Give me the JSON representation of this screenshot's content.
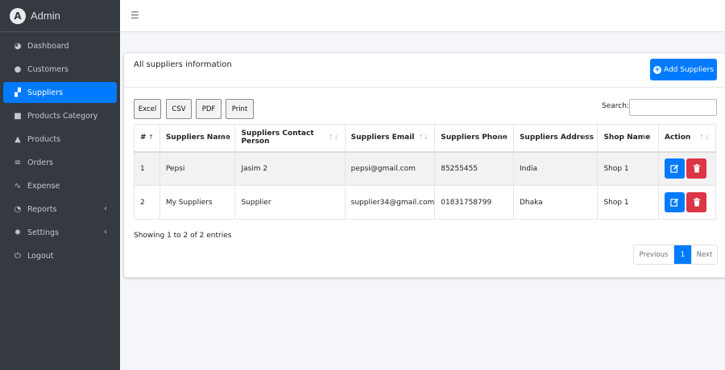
{
  "brand": {
    "name": "Admin",
    "logo_letter": "A"
  },
  "sidebar": {
    "items": [
      {
        "label": "Dashboard",
        "icon": "dashboard-icon",
        "glyph": "◕"
      },
      {
        "label": "Customers",
        "icon": "user-icon",
        "glyph": "●"
      },
      {
        "label": "Suppliers",
        "icon": "people-carry-icon",
        "glyph": "▞"
      },
      {
        "label": "Products Category",
        "icon": "book-icon",
        "glyph": "■"
      },
      {
        "label": "Products",
        "icon": "shopping-bag-icon",
        "glyph": "▲"
      },
      {
        "label": "Orders",
        "icon": "sort-list-icon",
        "glyph": "≡"
      },
      {
        "label": "Expense",
        "icon": "chart-line-icon",
        "glyph": "∿"
      },
      {
        "label": "Reports",
        "icon": "pie-chart-icon",
        "glyph": "◔",
        "caret": "‹"
      },
      {
        "label": "Settings",
        "icon": "gear-icon",
        "glyph": "✹",
        "caret": "‹"
      },
      {
        "label": "Logout",
        "icon": "power-icon",
        "glyph": "⏻"
      }
    ]
  },
  "card": {
    "title": "All suppliers information",
    "add_label": "Add Suppliers"
  },
  "exports": [
    "Excel",
    "CSV",
    "PDF",
    "Print"
  ],
  "search": {
    "label": "Search:",
    "value": ""
  },
  "table": {
    "headers": [
      "#",
      "Suppliers Name",
      "Suppliers Contact Person",
      "Suppliers Email",
      "Suppliers Phone",
      "Suppliers Address",
      "Shop Name",
      "Action"
    ],
    "rows": [
      [
        "1",
        "Pepsi",
        "Jasim 2",
        "pepsi@gmail.com",
        "85255455",
        "India",
        "Shop 1"
      ],
      [
        "2",
        "My Suppliers",
        "Supplier",
        "supplier34@gmail.com",
        "01831758799",
        "Dhaka",
        "Shop 1"
      ]
    ]
  },
  "info": "Showing 1 to 2 of 2 entries",
  "pagination": {
    "previous": "Previous",
    "current": "1",
    "next": "Next"
  },
  "colors": {
    "sidebar": "#343a40",
    "primary": "#007bff",
    "danger": "#dc3545"
  }
}
